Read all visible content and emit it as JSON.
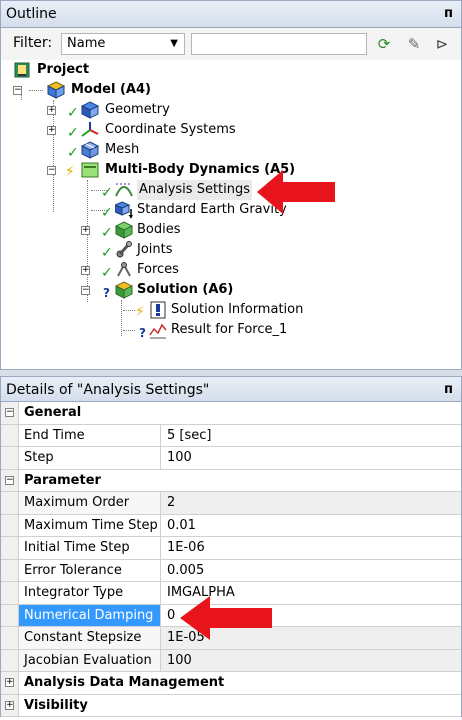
{
  "outline": {
    "title": "Outline",
    "pin": "ᴨ",
    "filter_label": "Filter:",
    "filter_value": "Name",
    "filter_text": ""
  },
  "tree": {
    "project": "Project",
    "model": "Model (A4)",
    "geometry": "Geometry",
    "coordinate_systems": "Coordinate Systems",
    "mesh": "Mesh",
    "mbd": "Multi-Body Dynamics (A5)",
    "analysis_settings": "Analysis Settings",
    "standard_earth_gravity": "Standard Earth Gravity",
    "bodies": "Bodies",
    "joints": "Joints",
    "forces": "Forces",
    "solution": "Solution (A6)",
    "solution_information": "Solution Information",
    "result_force": "Result for Force_1"
  },
  "details": {
    "title": "Details of \"Analysis Settings\"",
    "pin": "ᴨ",
    "general": "General",
    "end_time_label": "End Time",
    "end_time_value": "5 [sec]",
    "step_label": "Step",
    "step_value": "100",
    "parameter": "Parameter",
    "max_order_label": "Maximum Order",
    "max_order_value": "2",
    "max_time_step_label": "Maximum Time Step",
    "max_time_step_value": "0.01",
    "initial_time_step_label": "Initial Time Step",
    "initial_time_step_value": "1E-06",
    "error_tolerance_label": "Error Tolerance",
    "error_tolerance_value": "0.005",
    "integrator_type_label": "Integrator Type",
    "integrator_type_value": "IMGALPHA",
    "numerical_damping_label": "Numerical Damping",
    "numerical_damping_value": "0",
    "constant_stepsize_label": "Constant Stepsize",
    "constant_stepsize_value": "1E-05",
    "jacobian_label": "Jacobian Evaluation",
    "jacobian_value": "100",
    "analysis_data_management": "Analysis Data Management",
    "visibility": "Visibility"
  },
  "colors": {
    "selection": "#3399ff",
    "arrow": "#e8141b",
    "check": "#1e9a1e"
  }
}
